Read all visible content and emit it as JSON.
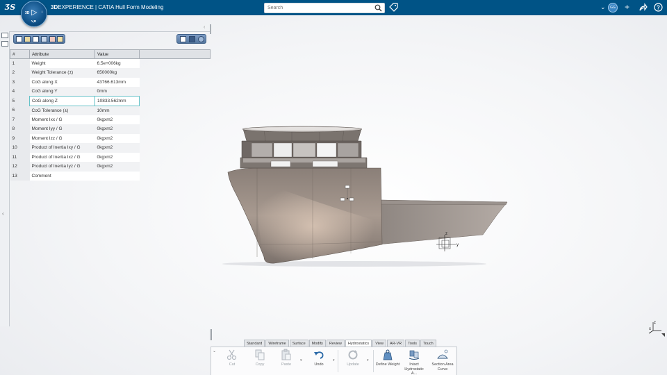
{
  "header": {
    "app_title_bold": "3D",
    "app_title_rest": "EXPERIENCE | CATIA Hull Form Modeling",
    "compass": {
      "left": "3D",
      "right": "i",
      "bottom": "V,R"
    },
    "search_placeholder": "Search",
    "user_badge": "GG",
    "brand_color": "#005386"
  },
  "panel": {
    "columns": [
      "#",
      "Attribute",
      "Value"
    ],
    "rows": [
      {
        "n": "1",
        "attr": "Weight",
        "value": "6.5e+006kg"
      },
      {
        "n": "2",
        "attr": "Weight Tolerance (±)",
        "value": "650000kg"
      },
      {
        "n": "3",
        "attr": "CoG along X",
        "value": "43766.613mm"
      },
      {
        "n": "4",
        "attr": "CoG along Y",
        "value": "0mm"
      },
      {
        "n": "5",
        "attr": "CoG along Z",
        "value": "10833.562mm"
      },
      {
        "n": "6",
        "attr": "CoG Tolerance (±)",
        "value": "10mm"
      },
      {
        "n": "7",
        "attr": "Moment Ixx / G",
        "value": "0kgxm2"
      },
      {
        "n": "8",
        "attr": "Moment Iyy / G",
        "value": "0kgxm2"
      },
      {
        "n": "9",
        "attr": "Moment Izz / G",
        "value": "0kgxm2"
      },
      {
        "n": "10",
        "attr": "Product of Inertia Ixy / G",
        "value": "0kgxm2"
      },
      {
        "n": "11",
        "attr": "Product of Inertia Ixz / G",
        "value": "0kgxm2"
      },
      {
        "n": "12",
        "attr": "Product of Inertia Iyz / G",
        "value": "0kgxm2"
      },
      {
        "n": "13",
        "attr": "Comment",
        "value": ""
      }
    ],
    "selected_row": "5"
  },
  "viewport": {
    "triad_labels": {
      "z": "z",
      "y": "y"
    },
    "compass_axis": {
      "z": "z",
      "x": "x"
    }
  },
  "action_bar": {
    "tabs": [
      "Standard",
      "Wireframe",
      "Surface",
      "Modify",
      "Review",
      "Hydrostatics",
      "View",
      "AR-VR",
      "Tools",
      "Touch"
    ],
    "active_tab": "Hydrostatics",
    "actions": {
      "cut": "Cut",
      "copy": "Copy",
      "paste": "Paste",
      "undo": "Undo",
      "update": "Update",
      "define_weight": "Define Weight",
      "intact_hydrostatic": "Intact Hydrostatic A...",
      "section_area_curve": "Section Area Curve"
    }
  }
}
